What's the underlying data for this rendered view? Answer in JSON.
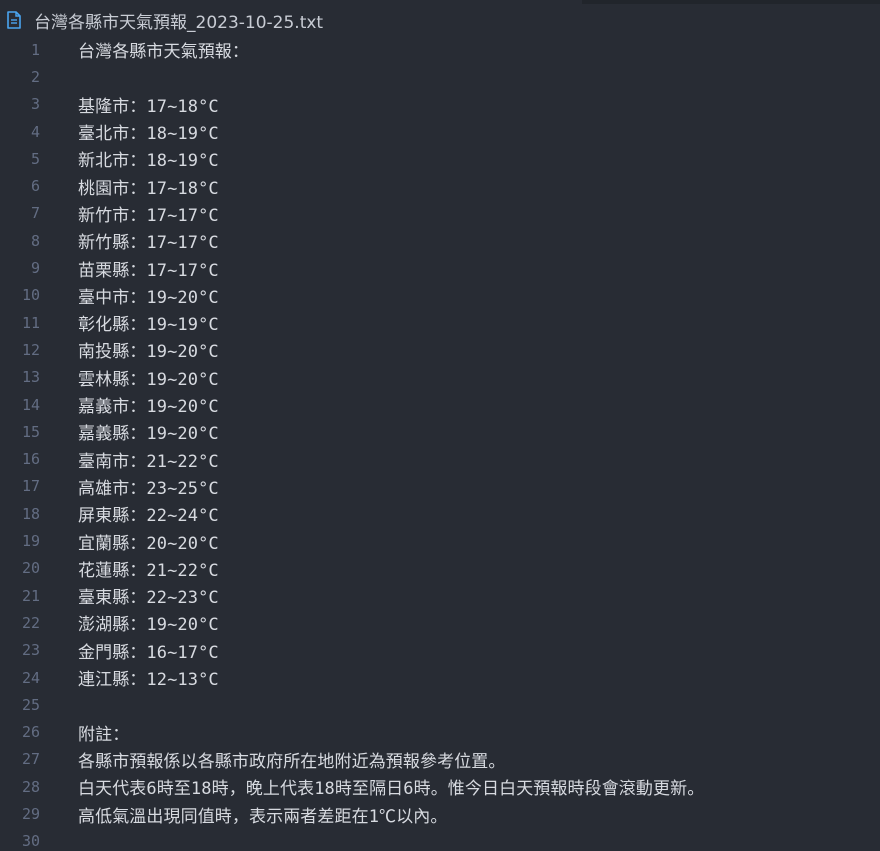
{
  "tab": {
    "title": "台灣各縣市天氣預報_2023-10-25.txt",
    "icon": "text-file-icon"
  },
  "colors": {
    "background": "#282c34",
    "text": "#d7dae0",
    "line_number": "#636d83",
    "icon": "#4aa5f0"
  },
  "lines": [
    {
      "number": "1",
      "text": "台灣各縣市天氣預報："
    },
    {
      "number": "2",
      "text": ""
    },
    {
      "number": "3",
      "text": "基隆市：17~18°C"
    },
    {
      "number": "4",
      "text": "臺北市：18~19°C"
    },
    {
      "number": "5",
      "text": "新北市：18~19°C"
    },
    {
      "number": "6",
      "text": "桃園市：17~18°C"
    },
    {
      "number": "7",
      "text": "新竹市：17~17°C"
    },
    {
      "number": "8",
      "text": "新竹縣：17~17°C"
    },
    {
      "number": "9",
      "text": "苗栗縣：17~17°C"
    },
    {
      "number": "10",
      "text": "臺中市：19~20°C"
    },
    {
      "number": "11",
      "text": "彰化縣：19~19°C"
    },
    {
      "number": "12",
      "text": "南投縣：19~20°C"
    },
    {
      "number": "13",
      "text": "雲林縣：19~20°C"
    },
    {
      "number": "14",
      "text": "嘉義市：19~20°C"
    },
    {
      "number": "15",
      "text": "嘉義縣：19~20°C"
    },
    {
      "number": "16",
      "text": "臺南市：21~22°C"
    },
    {
      "number": "17",
      "text": "高雄市：23~25°C"
    },
    {
      "number": "18",
      "text": "屏東縣：22~24°C"
    },
    {
      "number": "19",
      "text": "宜蘭縣：20~20°C"
    },
    {
      "number": "20",
      "text": "花蓮縣：21~22°C"
    },
    {
      "number": "21",
      "text": "臺東縣：22~23°C"
    },
    {
      "number": "22",
      "text": "澎湖縣：19~20°C"
    },
    {
      "number": "23",
      "text": "金門縣：16~17°C"
    },
    {
      "number": "24",
      "text": "連江縣：12~13°C"
    },
    {
      "number": "25",
      "text": ""
    },
    {
      "number": "26",
      "text": "附註："
    },
    {
      "number": "27",
      "text": "各縣市預報係以各縣市政府所在地附近為預報參考位置。"
    },
    {
      "number": "28",
      "text": "白天代表6時至18時，晚上代表18時至隔日6時。惟今日白天預報時段會滾動更新。"
    },
    {
      "number": "29",
      "text": "高低氣溫出現同值時，表示兩者差距在1℃以內。"
    },
    {
      "number": "30",
      "text": ""
    }
  ]
}
